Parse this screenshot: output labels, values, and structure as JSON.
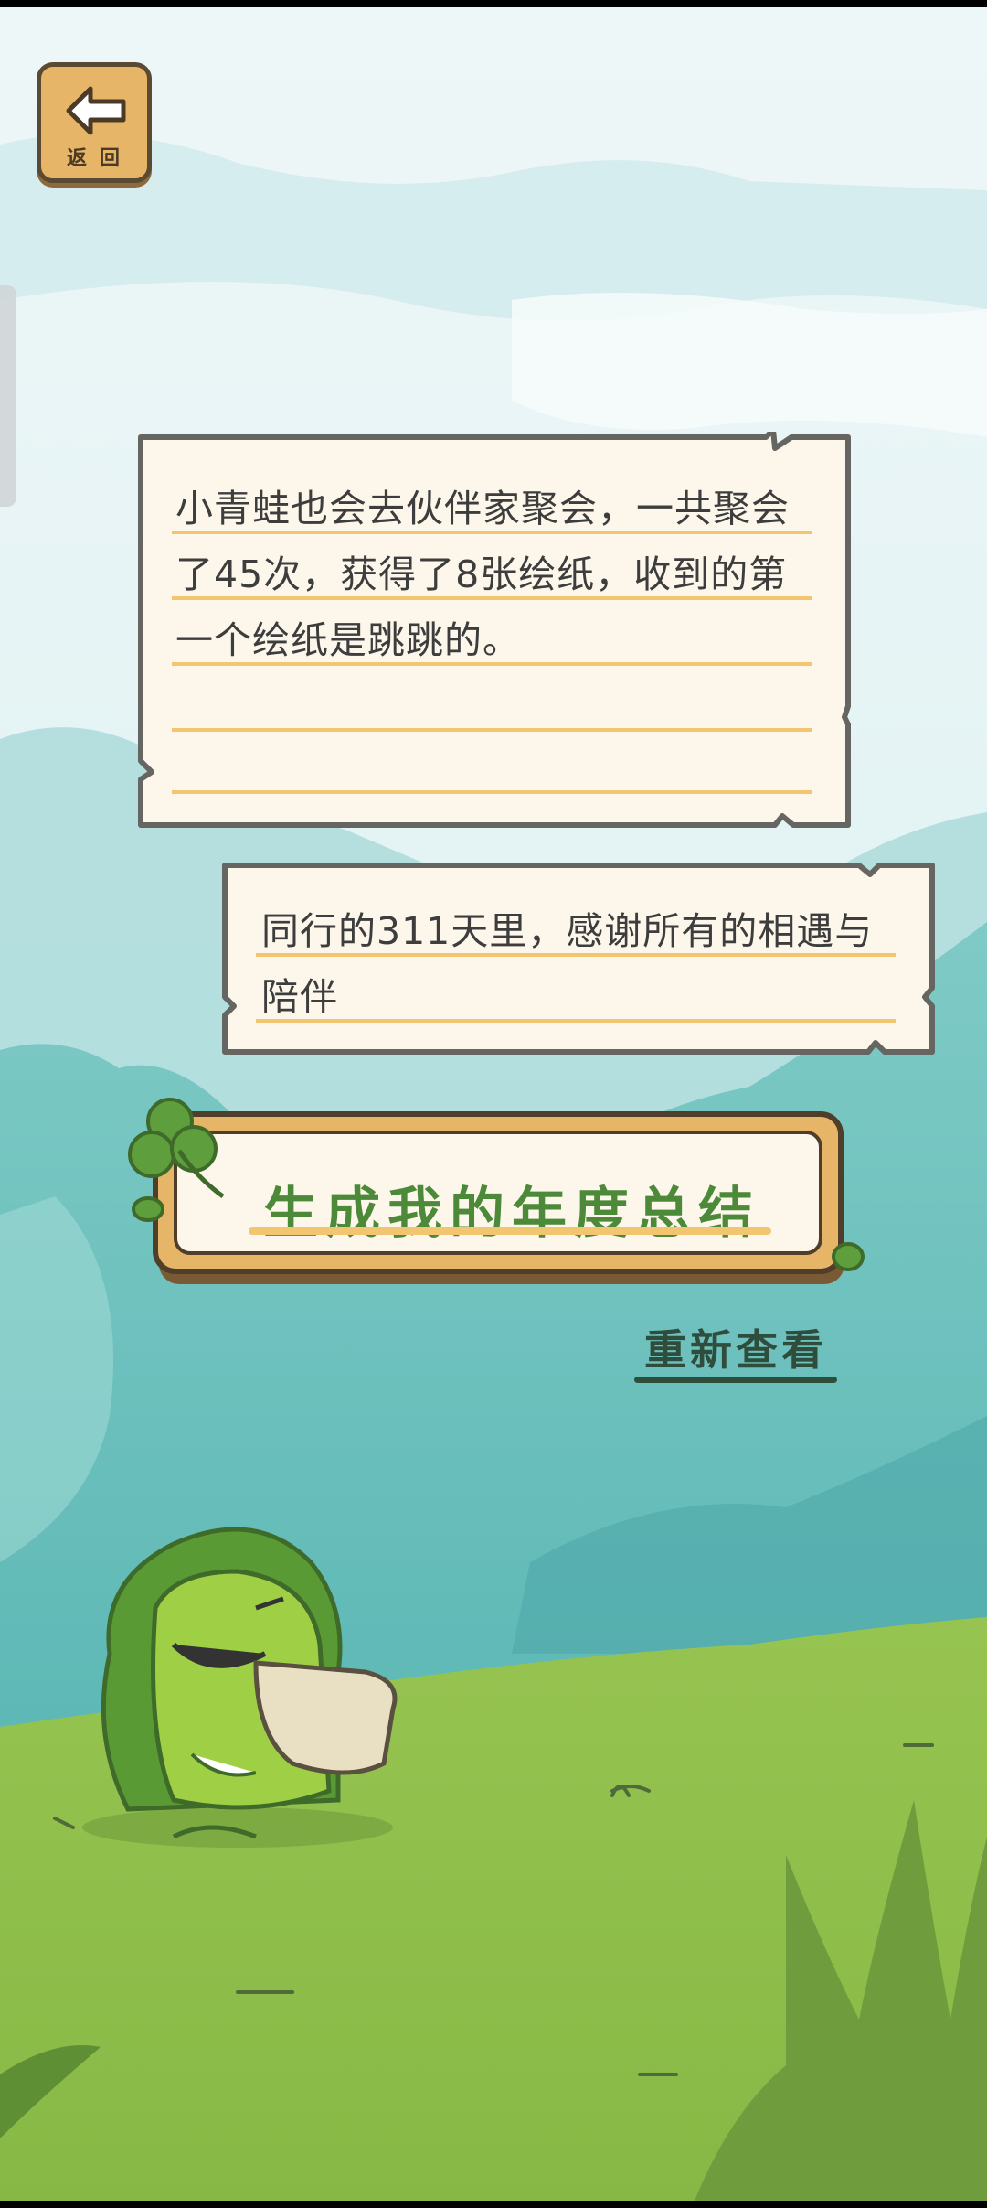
{
  "back_button": {
    "label": "返回",
    "icon": "back-arrow-icon"
  },
  "summary_note": {
    "text": "小青蛙也会去伙伴家聚会，一共聚会了45次，获得了8张绘纸，收到的第一个绘纸是跳跳的。"
  },
  "thanks_note": {
    "text": "同行的311天里，感谢所有的相遇与陪伴"
  },
  "generate_button": {
    "label": "生成我的年度总结",
    "icon": "clover-icon"
  },
  "replay_link": {
    "label": "重新查看"
  },
  "colors": {
    "sky": "#d8eef2",
    "mountain": "#6cc2c0",
    "grass": "#8fbf4a",
    "paper": "#fcf7ea",
    "paper_border": "#6a6a66",
    "line": "#f2c571",
    "button_wood": "#e7b567",
    "title_green": "#4c8a3a"
  }
}
